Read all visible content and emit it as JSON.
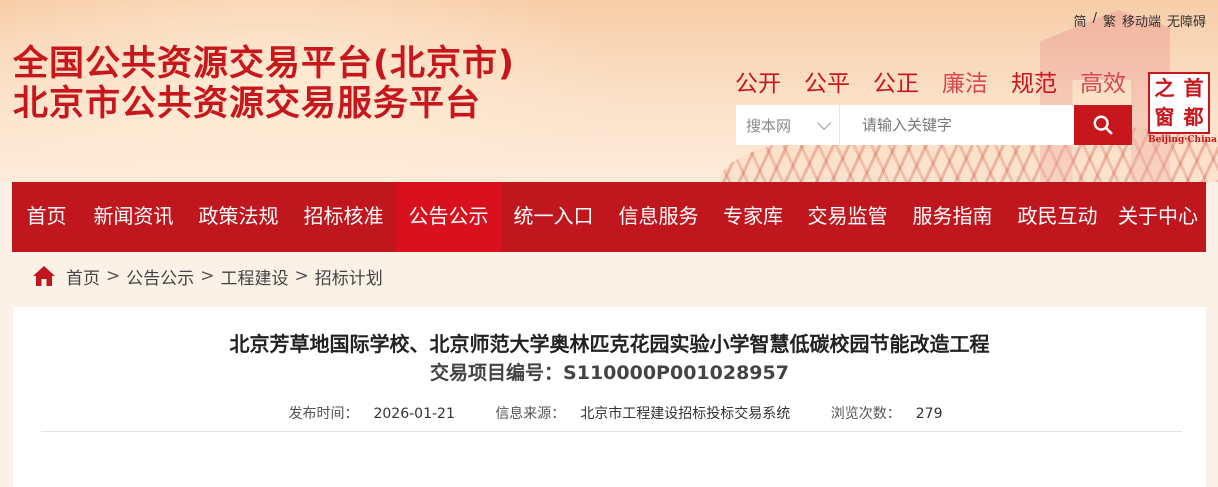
{
  "header": {
    "title_line1": "全国公共资源交易平台(北京市)",
    "title_line2": "北京市公共资源交易服务平台",
    "util_links": [
      "简",
      "/",
      "繁",
      "移动端",
      "无障碍"
    ],
    "values": [
      "公开",
      "公平",
      "公正",
      "廉洁",
      "规范",
      "高效"
    ],
    "search": {
      "scope_label": "搜本网",
      "placeholder": "请输入关键字",
      "button_icon": "search-icon"
    },
    "logo": {
      "chars": [
        "首",
        "都",
        "之",
        "窗"
      ],
      "caption": "Beijing·China"
    },
    "colors": {
      "brand_red": "#c8161d",
      "nav_bg": "#c0171f",
      "nav_active": "#d9101d"
    }
  },
  "nav": {
    "items": [
      "首页",
      "新闻资讯",
      "政策法规",
      "招标核准",
      "公告公示",
      "统一入口",
      "信息服务",
      "专家库",
      "交易监管",
      "服务指南",
      "政民互动",
      "关于中心"
    ],
    "active_index": 4
  },
  "breadcrumb": {
    "home_icon": "home-icon",
    "items": [
      "首页",
      "公告公示",
      "工程建设",
      "招标计划"
    ],
    "separator": ">"
  },
  "article": {
    "title": "北京芳草地国际学校、北京师范大学奥林匹克花园实验小学智慧低碳校园节能改造工程",
    "project_no_label": "交易项目编号：",
    "project_no": "S110000P001028957",
    "publish_label": "发布时间：",
    "publish_date": "2026-01-21",
    "source_label": "信息来源：",
    "source": "北京市工程建设招标投标交易系统",
    "views_label": "浏览次数：",
    "views": "279"
  }
}
